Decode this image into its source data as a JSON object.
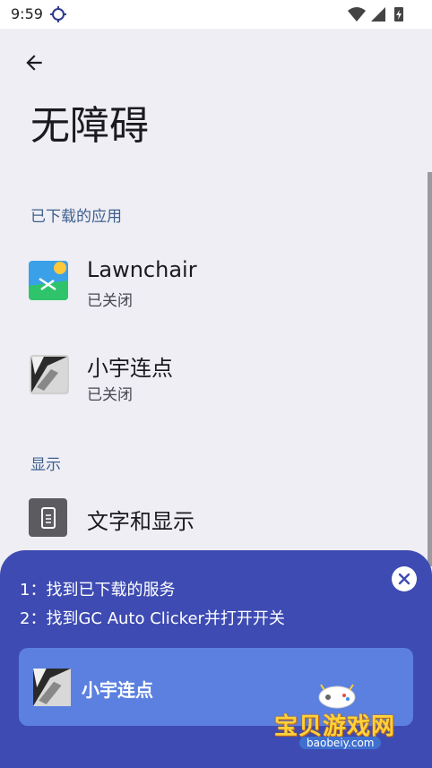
{
  "status_bar": {
    "time": "9:59",
    "icons": [
      "location-target-icon",
      "wifi-icon",
      "cell-signal-icon",
      "battery-charging-icon"
    ]
  },
  "header": {
    "back_icon": "arrow-left-icon",
    "title": "无障碍"
  },
  "sections": [
    {
      "title": "已下载的应用",
      "items": [
        {
          "name": "Lawnchair",
          "status": "已关闭",
          "icon": "lawnchair-app-icon"
        },
        {
          "name": "小宇连点",
          "status": "已关闭",
          "icon": "xiaoyu-app-icon"
        }
      ]
    },
    {
      "title": "显示",
      "items": [
        {
          "name": "文字和显示",
          "icon": "text-display-icon"
        }
      ]
    }
  ],
  "overlay": {
    "steps": [
      "1：找到已下载的服务",
      "2：找到GC Auto Clicker并打开开关"
    ],
    "close_icon": "close-icon",
    "app_card_label": "小宇连点"
  },
  "watermark": {
    "title": "宝贝游戏网",
    "url": "baobeiy.com"
  },
  "colors": {
    "background": "#efeef4",
    "accent_header": "#3d5f8f",
    "overlay": "#3e4bb2",
    "card": "#5b80e0"
  }
}
